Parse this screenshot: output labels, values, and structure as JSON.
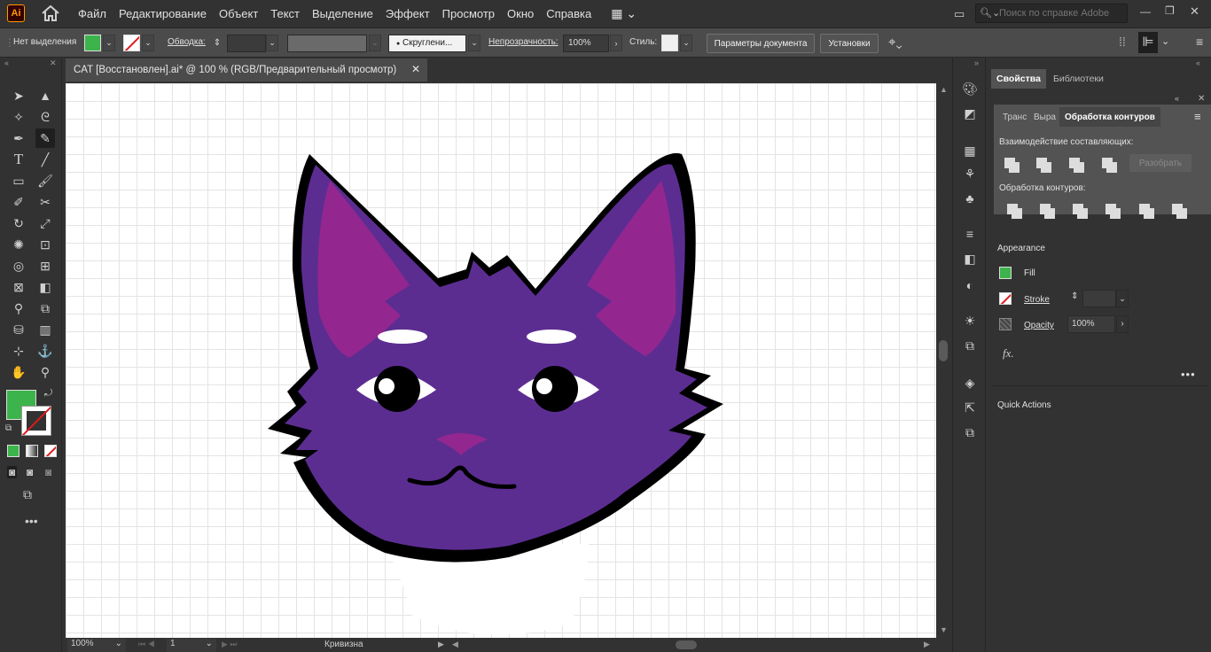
{
  "app": {
    "logo": "Ai",
    "colors": {
      "accent": "#3cb44b",
      "logo_border": "#ff9a00"
    }
  },
  "menu": [
    "Файл",
    "Редактирование",
    "Объект",
    "Текст",
    "Выделение",
    "Эффект",
    "Просмотр",
    "Окно",
    "Справка"
  ],
  "search": {
    "placeholder": "Поиск по справке Adobe"
  },
  "control_bar": {
    "selection": "Нет выделения",
    "stroke_label": "Обводка:",
    "brush_label": "Скруглени...",
    "opacity_label": "Непрозрачность:",
    "opacity_value": "100%",
    "style_label": "Стиль:",
    "doc_settings": "Параметры документа",
    "preferences": "Установки"
  },
  "document": {
    "tab_title": "CAT [Восстановлен].ai* @ 100 % (RGB/Предварительный просмотр)",
    "close_glyph": "✕"
  },
  "status_bar": {
    "zoom": "100%",
    "artboard": "1",
    "tool_name": "Кривизна"
  },
  "right_panel": {
    "tabs": [
      "Свойства",
      "Библиотеки"
    ],
    "pathfinder_tabs": [
      "Транс",
      "Выра",
      "Обработка контуров"
    ],
    "shape_modes_label": "Взаимодействие составляющих:",
    "expand_label": "Разобрать",
    "pathfinders_label": "Обработка контуров:",
    "appearance_title": "Appearance",
    "fill_label": "Fill",
    "stroke_label": "Stroke",
    "opacity_label": "Opacity",
    "opacity_value": "100%",
    "fx_label": "fx.",
    "quick_actions_title": "Quick Actions"
  }
}
